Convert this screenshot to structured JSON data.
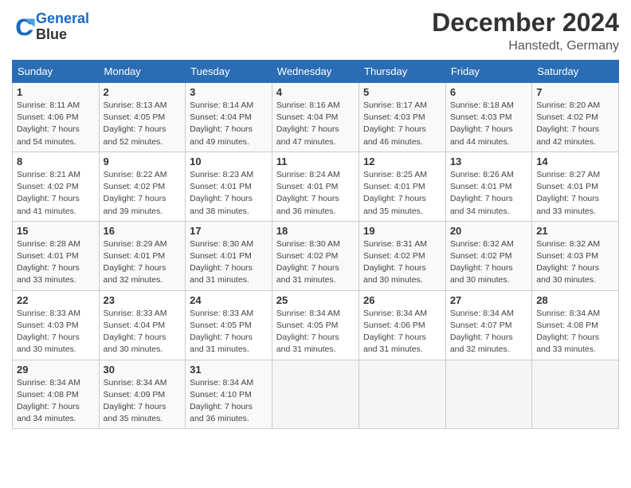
{
  "header": {
    "logo_line1": "General",
    "logo_line2": "Blue",
    "month_year": "December 2024",
    "location": "Hanstedt, Germany"
  },
  "weekdays": [
    "Sunday",
    "Monday",
    "Tuesday",
    "Wednesday",
    "Thursday",
    "Friday",
    "Saturday"
  ],
  "weeks": [
    [
      {
        "day": "1",
        "info": "Sunrise: 8:11 AM\nSunset: 4:06 PM\nDaylight: 7 hours\nand 54 minutes."
      },
      {
        "day": "2",
        "info": "Sunrise: 8:13 AM\nSunset: 4:05 PM\nDaylight: 7 hours\nand 52 minutes."
      },
      {
        "day": "3",
        "info": "Sunrise: 8:14 AM\nSunset: 4:04 PM\nDaylight: 7 hours\nand 49 minutes."
      },
      {
        "day": "4",
        "info": "Sunrise: 8:16 AM\nSunset: 4:04 PM\nDaylight: 7 hours\nand 47 minutes."
      },
      {
        "day": "5",
        "info": "Sunrise: 8:17 AM\nSunset: 4:03 PM\nDaylight: 7 hours\nand 46 minutes."
      },
      {
        "day": "6",
        "info": "Sunrise: 8:18 AM\nSunset: 4:03 PM\nDaylight: 7 hours\nand 44 minutes."
      },
      {
        "day": "7",
        "info": "Sunrise: 8:20 AM\nSunset: 4:02 PM\nDaylight: 7 hours\nand 42 minutes."
      }
    ],
    [
      {
        "day": "8",
        "info": "Sunrise: 8:21 AM\nSunset: 4:02 PM\nDaylight: 7 hours\nand 41 minutes."
      },
      {
        "day": "9",
        "info": "Sunrise: 8:22 AM\nSunset: 4:02 PM\nDaylight: 7 hours\nand 39 minutes."
      },
      {
        "day": "10",
        "info": "Sunrise: 8:23 AM\nSunset: 4:01 PM\nDaylight: 7 hours\nand 38 minutes."
      },
      {
        "day": "11",
        "info": "Sunrise: 8:24 AM\nSunset: 4:01 PM\nDaylight: 7 hours\nand 36 minutes."
      },
      {
        "day": "12",
        "info": "Sunrise: 8:25 AM\nSunset: 4:01 PM\nDaylight: 7 hours\nand 35 minutes."
      },
      {
        "day": "13",
        "info": "Sunrise: 8:26 AM\nSunset: 4:01 PM\nDaylight: 7 hours\nand 34 minutes."
      },
      {
        "day": "14",
        "info": "Sunrise: 8:27 AM\nSunset: 4:01 PM\nDaylight: 7 hours\nand 33 minutes."
      }
    ],
    [
      {
        "day": "15",
        "info": "Sunrise: 8:28 AM\nSunset: 4:01 PM\nDaylight: 7 hours\nand 33 minutes."
      },
      {
        "day": "16",
        "info": "Sunrise: 8:29 AM\nSunset: 4:01 PM\nDaylight: 7 hours\nand 32 minutes."
      },
      {
        "day": "17",
        "info": "Sunrise: 8:30 AM\nSunset: 4:01 PM\nDaylight: 7 hours\nand 31 minutes."
      },
      {
        "day": "18",
        "info": "Sunrise: 8:30 AM\nSunset: 4:02 PM\nDaylight: 7 hours\nand 31 minutes."
      },
      {
        "day": "19",
        "info": "Sunrise: 8:31 AM\nSunset: 4:02 PM\nDaylight: 7 hours\nand 30 minutes."
      },
      {
        "day": "20",
        "info": "Sunrise: 8:32 AM\nSunset: 4:02 PM\nDaylight: 7 hours\nand 30 minutes."
      },
      {
        "day": "21",
        "info": "Sunrise: 8:32 AM\nSunset: 4:03 PM\nDaylight: 7 hours\nand 30 minutes."
      }
    ],
    [
      {
        "day": "22",
        "info": "Sunrise: 8:33 AM\nSunset: 4:03 PM\nDaylight: 7 hours\nand 30 minutes."
      },
      {
        "day": "23",
        "info": "Sunrise: 8:33 AM\nSunset: 4:04 PM\nDaylight: 7 hours\nand 30 minutes."
      },
      {
        "day": "24",
        "info": "Sunrise: 8:33 AM\nSunset: 4:05 PM\nDaylight: 7 hours\nand 31 minutes."
      },
      {
        "day": "25",
        "info": "Sunrise: 8:34 AM\nSunset: 4:05 PM\nDaylight: 7 hours\nand 31 minutes."
      },
      {
        "day": "26",
        "info": "Sunrise: 8:34 AM\nSunset: 4:06 PM\nDaylight: 7 hours\nand 31 minutes."
      },
      {
        "day": "27",
        "info": "Sunrise: 8:34 AM\nSunset: 4:07 PM\nDaylight: 7 hours\nand 32 minutes."
      },
      {
        "day": "28",
        "info": "Sunrise: 8:34 AM\nSunset: 4:08 PM\nDaylight: 7 hours\nand 33 minutes."
      }
    ],
    [
      {
        "day": "29",
        "info": "Sunrise: 8:34 AM\nSunset: 4:08 PM\nDaylight: 7 hours\nand 34 minutes."
      },
      {
        "day": "30",
        "info": "Sunrise: 8:34 AM\nSunset: 4:09 PM\nDaylight: 7 hours\nand 35 minutes."
      },
      {
        "day": "31",
        "info": "Sunrise: 8:34 AM\nSunset: 4:10 PM\nDaylight: 7 hours\nand 36 minutes."
      },
      null,
      null,
      null,
      null
    ]
  ]
}
